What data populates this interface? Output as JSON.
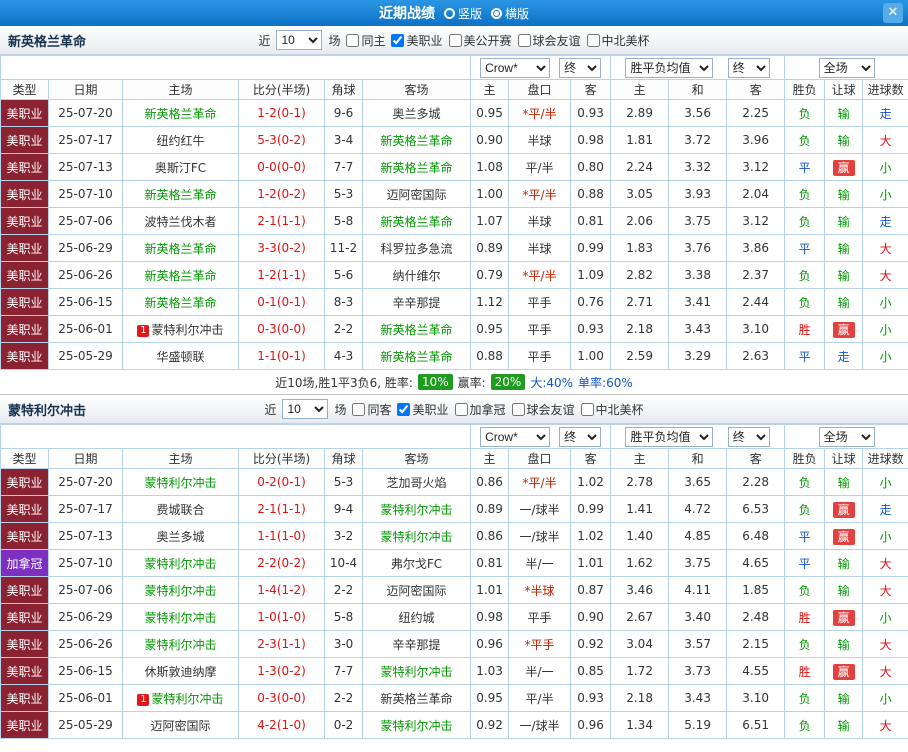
{
  "colors": {
    "titlebar_blue": "#1583d8",
    "league_mls_red": "#8b2232",
    "league_canada_purple": "#7c2fc0",
    "win_red": "#e21212",
    "lose_green": "#009900",
    "draw_blue": "#1155cc",
    "win_badge_red": "#e34040",
    "rate_badge_green": "#1f9c1f"
  },
  "titlebar": {
    "title": "近期战绩",
    "radios": [
      {
        "label": "竖版",
        "selected": false
      },
      {
        "label": "横版",
        "selected": true
      }
    ],
    "close": "✕"
  },
  "columns": [
    "类型",
    "日期",
    "主场",
    "比分(半场)",
    "角球",
    "客场",
    "主",
    "盘口",
    "客",
    "主",
    "和",
    "客",
    "胜负",
    "让球",
    "进球数"
  ],
  "dropdowns": {
    "company": "Crow*",
    "company_stage": "终",
    "avg": "胜平负均值",
    "avg_stage": "终",
    "scope": "全场"
  },
  "sections": [
    {
      "team": "新英格兰革命",
      "filters": {
        "near": "近",
        "count": "10",
        "matches": "场",
        "checkboxes": [
          {
            "label": "同主",
            "checked": false
          },
          {
            "label": "美职业",
            "checked": true
          },
          {
            "label": "美公开赛",
            "checked": false
          },
          {
            "label": "球会友谊",
            "checked": false
          },
          {
            "label": "中北美杯",
            "checked": false
          }
        ]
      },
      "rows": [
        {
          "league": "美职业",
          "league_cls": "lg-red",
          "date": "25-07-20",
          "home": "新英格兰革命",
          "home_cls": "tm-green",
          "home_badge": "",
          "score": "1-2(0-1)",
          "corners": "9-6",
          "away": "奥兰多城",
          "away_cls": "tm-dark",
          "away_badge": "",
          "o_home": "0.95",
          "hcp": "*平/半",
          "hcp_cls": "hcp-star",
          "o_away": "0.93",
          "avg_home": "2.89",
          "avg_draw": "3.56",
          "avg_away": "2.25",
          "result": "负",
          "result_cls": "mk-g",
          "give": "输",
          "give_cls": "mk-g",
          "goal": "走",
          "goal_cls": "mk-b"
        },
        {
          "league": "美职业",
          "league_cls": "lg-red",
          "date": "25-07-17",
          "home": "纽约红牛",
          "home_cls": "tm-dark",
          "home_badge": "",
          "score": "5-3(0-2)",
          "corners": "3-4",
          "away": "新英格兰革命",
          "away_cls": "tm-green",
          "away_badge": "",
          "o_home": "0.90",
          "hcp": "半球",
          "hcp_cls": "hcp-plain",
          "o_away": "0.98",
          "avg_home": "1.81",
          "avg_draw": "3.72",
          "avg_away": "3.96",
          "result": "负",
          "result_cls": "mk-g",
          "give": "输",
          "give_cls": "mk-g",
          "goal": "大",
          "goal_cls": "mk-r"
        },
        {
          "league": "美职业",
          "league_cls": "lg-red",
          "date": "25-07-13",
          "home": "奥斯汀FC",
          "home_cls": "tm-dark",
          "home_badge": "",
          "score": "0-0(0-0)",
          "corners": "7-7",
          "away": "新英格兰革命",
          "away_cls": "tm-green",
          "away_badge": "",
          "o_home": "1.08",
          "hcp": "平/半",
          "hcp_cls": "hcp-plain",
          "o_away": "0.80",
          "avg_home": "2.24",
          "avg_draw": "3.32",
          "avg_away": "3.12",
          "result": "平",
          "result_cls": "mk-b",
          "give": "赢",
          "give_cls": "mk-rb",
          "goal": "小",
          "goal_cls": "mk-g"
        },
        {
          "league": "美职业",
          "league_cls": "lg-red",
          "date": "25-07-10",
          "home": "新英格兰革命",
          "home_cls": "tm-green",
          "home_badge": "",
          "score": "1-2(0-2)",
          "corners": "5-3",
          "away": "迈阿密国际",
          "away_cls": "tm-dark",
          "away_badge": "",
          "o_home": "1.00",
          "hcp": "*平/半",
          "hcp_cls": "hcp-star",
          "o_away": "0.88",
          "avg_home": "3.05",
          "avg_draw": "3.93",
          "avg_away": "2.04",
          "result": "负",
          "result_cls": "mk-g",
          "give": "输",
          "give_cls": "mk-g",
          "goal": "小",
          "goal_cls": "mk-g"
        },
        {
          "league": "美职业",
          "league_cls": "lg-red",
          "date": "25-07-06",
          "home": "波特兰伐木者",
          "home_cls": "tm-dark",
          "home_badge": "",
          "score": "2-1(1-1)",
          "corners": "5-8",
          "away": "新英格兰革命",
          "away_cls": "tm-green",
          "away_badge": "",
          "o_home": "1.07",
          "hcp": "半球",
          "hcp_cls": "hcp-plain",
          "o_away": "0.81",
          "avg_home": "2.06",
          "avg_draw": "3.75",
          "avg_away": "3.12",
          "result": "负",
          "result_cls": "mk-g",
          "give": "输",
          "give_cls": "mk-g",
          "goal": "走",
          "goal_cls": "mk-b"
        },
        {
          "league": "美职业",
          "league_cls": "lg-red",
          "date": "25-06-29",
          "home": "新英格兰革命",
          "home_cls": "tm-green",
          "home_badge": "",
          "score": "3-3(0-2)",
          "corners": "11-2",
          "away": "科罗拉多急流",
          "away_cls": "tm-dark",
          "away_badge": "",
          "o_home": "0.89",
          "hcp": "半球",
          "hcp_cls": "hcp-plain",
          "o_away": "0.99",
          "avg_home": "1.83",
          "avg_draw": "3.76",
          "avg_away": "3.86",
          "result": "平",
          "result_cls": "mk-b",
          "give": "输",
          "give_cls": "mk-g",
          "goal": "大",
          "goal_cls": "mk-r"
        },
        {
          "league": "美职业",
          "league_cls": "lg-red",
          "date": "25-06-26",
          "home": "新英格兰革命",
          "home_cls": "tm-green",
          "home_badge": "",
          "score": "1-2(1-1)",
          "corners": "5-6",
          "away": "纳什维尔",
          "away_cls": "tm-dark",
          "away_badge": "",
          "o_home": "0.79",
          "hcp": "*平/半",
          "hcp_cls": "hcp-star",
          "o_away": "1.09",
          "avg_home": "2.82",
          "avg_draw": "3.38",
          "avg_away": "2.37",
          "result": "负",
          "result_cls": "mk-g",
          "give": "输",
          "give_cls": "mk-g",
          "goal": "大",
          "goal_cls": "mk-r"
        },
        {
          "league": "美职业",
          "league_cls": "lg-red",
          "date": "25-06-15",
          "home": "新英格兰革命",
          "home_cls": "tm-green",
          "home_badge": "",
          "score": "0-1(0-1)",
          "corners": "8-3",
          "away": "辛辛那提",
          "away_cls": "tm-dark",
          "away_badge": "",
          "o_home": "1.12",
          "hcp": "平手",
          "hcp_cls": "hcp-plain",
          "o_away": "0.76",
          "avg_home": "2.71",
          "avg_draw": "3.41",
          "avg_away": "2.44",
          "result": "负",
          "result_cls": "mk-g",
          "give": "输",
          "give_cls": "mk-g",
          "goal": "小",
          "goal_cls": "mk-g"
        },
        {
          "league": "美职业",
          "league_cls": "lg-red",
          "date": "25-06-01",
          "home": "蒙特利尔冲击",
          "home_cls": "tm-dark",
          "home_badge": "1",
          "score": "0-3(0-0)",
          "corners": "2-2",
          "away": "新英格兰革命",
          "away_cls": "tm-green",
          "away_badge": "",
          "o_home": "0.95",
          "hcp": "平手",
          "hcp_cls": "hcp-plain",
          "o_away": "0.93",
          "avg_home": "2.18",
          "avg_draw": "3.43",
          "avg_away": "3.10",
          "result": "胜",
          "result_cls": "mk-r",
          "give": "赢",
          "give_cls": "mk-rb",
          "goal": "小",
          "goal_cls": "mk-g"
        },
        {
          "league": "美职业",
          "league_cls": "lg-red",
          "date": "25-05-29",
          "home": "华盛顿联",
          "home_cls": "tm-dark",
          "home_badge": "",
          "score": "1-1(0-1)",
          "corners": "4-3",
          "away": "新英格兰革命",
          "away_cls": "tm-green",
          "away_badge": "",
          "o_home": "0.88",
          "hcp": "平手",
          "hcp_cls": "hcp-plain",
          "o_away": "1.00",
          "avg_home": "2.59",
          "avg_draw": "3.29",
          "avg_away": "2.63",
          "result": "平",
          "result_cls": "mk-b",
          "give": "走",
          "give_cls": "mk-b",
          "goal": "小",
          "goal_cls": "mk-g"
        }
      ],
      "summary": [
        {
          "text": "近10场,胜1平3负6, 胜率:",
          "style": "plain"
        },
        {
          "text": "10%",
          "style": "green-badge"
        },
        {
          "text": "赢率:",
          "style": "plain"
        },
        {
          "text": "20%",
          "style": "green-badge"
        },
        {
          "text": "大:40%",
          "style": "blue"
        },
        {
          "text": "单率:60%",
          "style": "blue"
        }
      ]
    },
    {
      "team": "蒙特利尔冲击",
      "filters": {
        "near": "近",
        "count": "10",
        "matches": "场",
        "checkboxes": [
          {
            "label": "同客",
            "checked": false
          },
          {
            "label": "美职业",
            "checked": true
          },
          {
            "label": "加拿冠",
            "checked": false
          },
          {
            "label": "球会友谊",
            "checked": false
          },
          {
            "label": "中北美杯",
            "checked": false
          }
        ]
      },
      "rows": [
        {
          "league": "美职业",
          "league_cls": "lg-red",
          "date": "25-07-20",
          "home": "蒙特利尔冲击",
          "home_cls": "tm-green",
          "home_badge": "",
          "score": "0-2(0-1)",
          "corners": "5-3",
          "away": "芝加哥火焰",
          "away_cls": "tm-dark",
          "away_badge": "",
          "o_home": "0.86",
          "hcp": "*平/半",
          "hcp_cls": "hcp-star",
          "o_away": "1.02",
          "avg_home": "2.78",
          "avg_draw": "3.65",
          "avg_away": "2.28",
          "result": "负",
          "result_cls": "mk-g",
          "give": "输",
          "give_cls": "mk-g",
          "goal": "小",
          "goal_cls": "mk-g"
        },
        {
          "league": "美职业",
          "league_cls": "lg-red",
          "date": "25-07-17",
          "home": "费城联合",
          "home_cls": "tm-dark",
          "home_badge": "",
          "score": "2-1(1-1)",
          "corners": "9-4",
          "away": "蒙特利尔冲击",
          "away_cls": "tm-green",
          "away_badge": "",
          "o_home": "0.89",
          "hcp": "一/球半",
          "hcp_cls": "hcp-plain",
          "o_away": "0.99",
          "avg_home": "1.41",
          "avg_draw": "4.72",
          "avg_away": "6.53",
          "result": "负",
          "result_cls": "mk-g",
          "give": "赢",
          "give_cls": "mk-rb",
          "goal": "走",
          "goal_cls": "mk-b"
        },
        {
          "league": "美职业",
          "league_cls": "lg-red",
          "date": "25-07-13",
          "home": "奥兰多城",
          "home_cls": "tm-dark",
          "home_badge": "",
          "score": "1-1(1-0)",
          "corners": "3-2",
          "away": "蒙特利尔冲击",
          "away_cls": "tm-green",
          "away_badge": "",
          "o_home": "0.86",
          "hcp": "一/球半",
          "hcp_cls": "hcp-plain",
          "o_away": "1.02",
          "avg_home": "1.40",
          "avg_draw": "4.85",
          "avg_away": "6.48",
          "result": "平",
          "result_cls": "mk-b",
          "give": "赢",
          "give_cls": "mk-rb",
          "goal": "小",
          "goal_cls": "mk-g"
        },
        {
          "league": "加拿冠",
          "league_cls": "lg-purple",
          "date": "25-07-10",
          "home": "蒙特利尔冲击",
          "home_cls": "tm-green",
          "home_badge": "",
          "score": "2-2(0-2)",
          "corners": "10-4",
          "away": "弗尔戈FC",
          "away_cls": "tm-dark",
          "away_badge": "",
          "o_home": "0.81",
          "hcp": "半/一",
          "hcp_cls": "hcp-plain",
          "o_away": "1.01",
          "avg_home": "1.62",
          "avg_draw": "3.75",
          "avg_away": "4.65",
          "result": "平",
          "result_cls": "mk-b",
          "give": "输",
          "give_cls": "mk-g",
          "goal": "大",
          "goal_cls": "mk-r"
        },
        {
          "league": "美职业",
          "league_cls": "lg-red",
          "date": "25-07-06",
          "home": "蒙特利尔冲击",
          "home_cls": "tm-green",
          "home_badge": "",
          "score": "1-4(1-2)",
          "corners": "2-2",
          "away": "迈阿密国际",
          "away_cls": "tm-dark",
          "away_badge": "",
          "o_home": "1.01",
          "hcp": "*半球",
          "hcp_cls": "hcp-star",
          "o_away": "0.87",
          "avg_home": "3.46",
          "avg_draw": "4.11",
          "avg_away": "1.85",
          "result": "负",
          "result_cls": "mk-g",
          "give": "输",
          "give_cls": "mk-g",
          "goal": "大",
          "goal_cls": "mk-r"
        },
        {
          "league": "美职业",
          "league_cls": "lg-red",
          "date": "25-06-29",
          "home": "蒙特利尔冲击",
          "home_cls": "tm-green",
          "home_badge": "",
          "score": "1-0(1-0)",
          "corners": "5-8",
          "away": "纽约城",
          "away_cls": "tm-dark",
          "away_badge": "",
          "o_home": "0.98",
          "hcp": "平手",
          "hcp_cls": "hcp-plain",
          "o_away": "0.90",
          "avg_home": "2.67",
          "avg_draw": "3.40",
          "avg_away": "2.48",
          "result": "胜",
          "result_cls": "mk-r",
          "give": "赢",
          "give_cls": "mk-rb",
          "goal": "小",
          "goal_cls": "mk-g"
        },
        {
          "league": "美职业",
          "league_cls": "lg-red",
          "date": "25-06-26",
          "home": "蒙特利尔冲击",
          "home_cls": "tm-green",
          "home_badge": "",
          "score": "2-3(1-1)",
          "corners": "3-0",
          "away": "辛辛那提",
          "away_cls": "tm-dark",
          "away_badge": "",
          "o_home": "0.96",
          "hcp": "*平手",
          "hcp_cls": "hcp-star",
          "o_away": "0.92",
          "avg_home": "3.04",
          "avg_draw": "3.57",
          "avg_away": "2.15",
          "result": "负",
          "result_cls": "mk-g",
          "give": "输",
          "give_cls": "mk-g",
          "goal": "大",
          "goal_cls": "mk-r"
        },
        {
          "league": "美职业",
          "league_cls": "lg-red",
          "date": "25-06-15",
          "home": "休斯敦迪纳摩",
          "home_cls": "tm-dark",
          "home_badge": "",
          "score": "1-3(0-2)",
          "corners": "7-7",
          "away": "蒙特利尔冲击",
          "away_cls": "tm-green",
          "away_badge": "",
          "o_home": "1.03",
          "hcp": "半/一",
          "hcp_cls": "hcp-plain",
          "o_away": "0.85",
          "avg_home": "1.72",
          "avg_draw": "3.73",
          "avg_away": "4.55",
          "result": "胜",
          "result_cls": "mk-r",
          "give": "赢",
          "give_cls": "mk-rb",
          "goal": "大",
          "goal_cls": "mk-r"
        },
        {
          "league": "美职业",
          "league_cls": "lg-red",
          "date": "25-06-01",
          "home": "蒙特利尔冲击",
          "home_cls": "tm-green",
          "home_badge": "1",
          "score": "0-3(0-0)",
          "corners": "2-2",
          "away": "新英格兰革命",
          "away_cls": "tm-dark",
          "away_badge": "",
          "o_home": "0.95",
          "hcp": "平/半",
          "hcp_cls": "hcp-plain",
          "o_away": "0.93",
          "avg_home": "2.18",
          "avg_draw": "3.43",
          "avg_away": "3.10",
          "result": "负",
          "result_cls": "mk-g",
          "give": "输",
          "give_cls": "mk-g",
          "goal": "小",
          "goal_cls": "mk-g"
        },
        {
          "league": "美职业",
          "league_cls": "lg-red",
          "date": "25-05-29",
          "home": "迈阿密国际",
          "home_cls": "tm-dark",
          "home_badge": "",
          "score": "4-2(1-0)",
          "corners": "0-2",
          "away": "蒙特利尔冲击",
          "away_cls": "tm-green",
          "away_badge": "",
          "o_home": "0.92",
          "hcp": "一/球半",
          "hcp_cls": "hcp-plain",
          "o_away": "0.96",
          "avg_home": "1.34",
          "avg_draw": "5.19",
          "avg_away": "6.51",
          "result": "负",
          "result_cls": "mk-g",
          "give": "输",
          "give_cls": "mk-g",
          "goal": "大",
          "goal_cls": "mk-r"
        }
      ],
      "summary": []
    }
  ]
}
